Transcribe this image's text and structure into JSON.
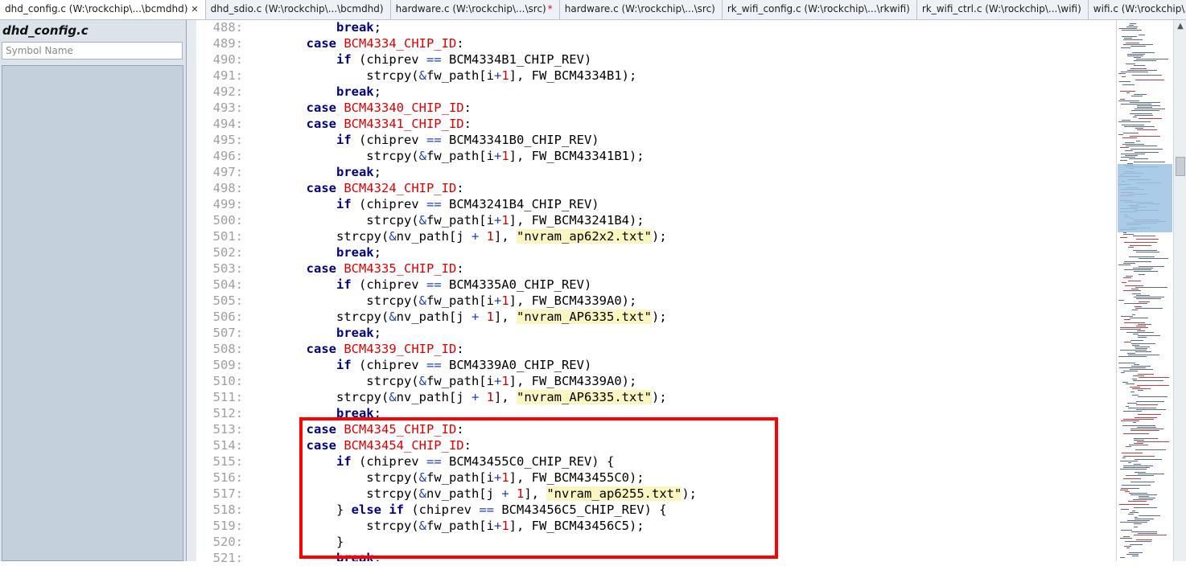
{
  "tabs": [
    {
      "label": "dhd_config.c (W:\\rockchip\\...\\bcmdhd)",
      "active": true,
      "close": "✕",
      "modified": ""
    },
    {
      "label": "dhd_sdio.c (W:\\rockchip\\...\\bcmdhd)",
      "active": false,
      "close": "",
      "modified": ""
    },
    {
      "label": "hardware.c (W:\\rockchip\\...\\src)",
      "active": false,
      "close": "",
      "modified": "*"
    },
    {
      "label": "hardware.c (W:\\rockchip\\...\\src)",
      "active": false,
      "close": "",
      "modified": ""
    },
    {
      "label": "rk_wifi_config.c (W:\\rockchip\\...\\rkwifi)",
      "active": false,
      "close": "",
      "modified": ""
    },
    {
      "label": "rk_wifi_ctrl.c (W:\\rockchip\\...\\wifi)",
      "active": false,
      "close": "",
      "modified": ""
    },
    {
      "label": "wifi.c (W:\\rockchip\\...\\wifi)",
      "active": false,
      "close": "",
      "modified": ""
    }
  ],
  "panel": {
    "title": "dhd_config.c",
    "search_placeholder": "Symbol Name"
  },
  "editor": {
    "line_numbers": [
      "488:",
      "489:",
      "490:",
      "491:",
      "492:",
      "493:",
      "494:",
      "495:",
      "496:",
      "497:",
      "498:",
      "499:",
      "500:",
      "501:",
      "502:",
      "503:",
      "504:",
      "505:",
      "506:",
      "507:",
      "508:",
      "509:",
      "510:",
      "511:",
      "512:",
      "513:",
      "514:",
      "515:",
      "516:",
      "517:",
      "518:",
      "519:",
      "520:",
      "521:"
    ],
    "lines": [
      [
        {
          "t": "            "
        },
        {
          "t": "break",
          "c": "kw"
        },
        {
          "t": ";"
        }
      ],
      [
        {
          "t": "        "
        },
        {
          "t": "case",
          "c": "kw"
        },
        {
          "t": " "
        },
        {
          "t": "BCM4334_CHIP_ID",
          "c": "mac"
        },
        {
          "t": ":"
        }
      ],
      [
        {
          "t": "            "
        },
        {
          "t": "if",
          "c": "kw"
        },
        {
          "t": " (chiprev "
        },
        {
          "t": "==",
          "c": "op"
        },
        {
          "t": " BCM4334B1_CHIP_REV)"
        }
      ],
      [
        {
          "t": "                strcpy("
        },
        {
          "t": "&",
          "c": "op"
        },
        {
          "t": "fw_path[i"
        },
        {
          "t": "+",
          "c": "op"
        },
        {
          "t": "1",
          "c": "num"
        },
        {
          "t": "], FW_BCM4334B1);"
        }
      ],
      [
        {
          "t": "            "
        },
        {
          "t": "break",
          "c": "kw"
        },
        {
          "t": ";"
        }
      ],
      [
        {
          "t": "        "
        },
        {
          "t": "case",
          "c": "kw"
        },
        {
          "t": " "
        },
        {
          "t": "BCM43340_CHIP_ID",
          "c": "mac"
        },
        {
          "t": ":"
        }
      ],
      [
        {
          "t": "        "
        },
        {
          "t": "case",
          "c": "kw"
        },
        {
          "t": " "
        },
        {
          "t": "BCM43341_CHIP_ID",
          "c": "mac"
        },
        {
          "t": ":"
        }
      ],
      [
        {
          "t": "            "
        },
        {
          "t": "if",
          "c": "kw"
        },
        {
          "t": " (chiprev "
        },
        {
          "t": "==",
          "c": "op"
        },
        {
          "t": " BCM43341B0_CHIP_REV)"
        }
      ],
      [
        {
          "t": "                strcpy("
        },
        {
          "t": "&",
          "c": "op"
        },
        {
          "t": "fw_path[i"
        },
        {
          "t": "+",
          "c": "op"
        },
        {
          "t": "1",
          "c": "num"
        },
        {
          "t": "], FW_BCM43341B1);"
        }
      ],
      [
        {
          "t": "            "
        },
        {
          "t": "break",
          "c": "kw"
        },
        {
          "t": ";"
        }
      ],
      [
        {
          "t": "        "
        },
        {
          "t": "case",
          "c": "kw"
        },
        {
          "t": " "
        },
        {
          "t": "BCM4324_CHIP_ID",
          "c": "mac"
        },
        {
          "t": ":"
        }
      ],
      [
        {
          "t": "            "
        },
        {
          "t": "if",
          "c": "kw"
        },
        {
          "t": " (chiprev "
        },
        {
          "t": "==",
          "c": "op"
        },
        {
          "t": " BCM43241B4_CHIP_REV)"
        }
      ],
      [
        {
          "t": "                strcpy("
        },
        {
          "t": "&",
          "c": "op"
        },
        {
          "t": "fw_path[i"
        },
        {
          "t": "+",
          "c": "op"
        },
        {
          "t": "1",
          "c": "num"
        },
        {
          "t": "], FW_BCM43241B4);"
        }
      ],
      [
        {
          "t": "            strcpy("
        },
        {
          "t": "&",
          "c": "op"
        },
        {
          "t": "nv_path[j "
        },
        {
          "t": "+",
          "c": "op"
        },
        {
          "t": " "
        },
        {
          "t": "1",
          "c": "num"
        },
        {
          "t": "], "
        },
        {
          "t": "\"nvram_ap62x2.txt\"",
          "c": "str"
        },
        {
          "t": ");"
        }
      ],
      [
        {
          "t": "            "
        },
        {
          "t": "break",
          "c": "kw"
        },
        {
          "t": ";"
        }
      ],
      [
        {
          "t": "        "
        },
        {
          "t": "case",
          "c": "kw"
        },
        {
          "t": " "
        },
        {
          "t": "BCM4335_CHIP_ID",
          "c": "mac"
        },
        {
          "t": ":"
        }
      ],
      [
        {
          "t": "            "
        },
        {
          "t": "if",
          "c": "kw"
        },
        {
          "t": " (chiprev "
        },
        {
          "t": "==",
          "c": "op"
        },
        {
          "t": " BCM4335A0_CHIP_REV)"
        }
      ],
      [
        {
          "t": "                strcpy("
        },
        {
          "t": "&",
          "c": "op"
        },
        {
          "t": "fw_path[i"
        },
        {
          "t": "+",
          "c": "op"
        },
        {
          "t": "1",
          "c": "num"
        },
        {
          "t": "], FW_BCM4339A0);"
        }
      ],
      [
        {
          "t": "            strcpy("
        },
        {
          "t": "&",
          "c": "op"
        },
        {
          "t": "nv_path[j "
        },
        {
          "t": "+",
          "c": "op"
        },
        {
          "t": " "
        },
        {
          "t": "1",
          "c": "num"
        },
        {
          "t": "], "
        },
        {
          "t": "\"nvram_AP6335.txt\"",
          "c": "str"
        },
        {
          "t": ");"
        }
      ],
      [
        {
          "t": "            "
        },
        {
          "t": "break",
          "c": "kw"
        },
        {
          "t": ";"
        }
      ],
      [
        {
          "t": "        "
        },
        {
          "t": "case",
          "c": "kw"
        },
        {
          "t": " "
        },
        {
          "t": "BCM4339_CHIP_ID",
          "c": "mac"
        },
        {
          "t": ":"
        }
      ],
      [
        {
          "t": "            "
        },
        {
          "t": "if",
          "c": "kw"
        },
        {
          "t": " (chiprev "
        },
        {
          "t": "==",
          "c": "op"
        },
        {
          "t": " BCM4339A0_CHIP_REV)"
        }
      ],
      [
        {
          "t": "                strcpy("
        },
        {
          "t": "&",
          "c": "op"
        },
        {
          "t": "fw_path[i"
        },
        {
          "t": "+",
          "c": "op"
        },
        {
          "t": "1",
          "c": "num"
        },
        {
          "t": "], FW_BCM4339A0);"
        }
      ],
      [
        {
          "t": "            strcpy("
        },
        {
          "t": "&",
          "c": "op"
        },
        {
          "t": "nv_path[j "
        },
        {
          "t": "+",
          "c": "op"
        },
        {
          "t": " "
        },
        {
          "t": "1",
          "c": "num"
        },
        {
          "t": "], "
        },
        {
          "t": "\"nvram_AP6335.txt\"",
          "c": "str"
        },
        {
          "t": ");"
        }
      ],
      [
        {
          "t": "            "
        },
        {
          "t": "break",
          "c": "kw"
        },
        {
          "t": ";"
        }
      ],
      [
        {
          "t": "        "
        },
        {
          "t": "case",
          "c": "kw"
        },
        {
          "t": " "
        },
        {
          "t": "BCM4345_CHIP_ID",
          "c": "mac"
        },
        {
          "t": ":"
        }
      ],
      [
        {
          "t": "        "
        },
        {
          "t": "case",
          "c": "kw"
        },
        {
          "t": " "
        },
        {
          "t": "BCM43454_CHIP_ID",
          "c": "mac"
        },
        {
          "t": ":"
        }
      ],
      [
        {
          "t": "            "
        },
        {
          "t": "if",
          "c": "kw"
        },
        {
          "t": " (chiprev "
        },
        {
          "t": "==",
          "c": "op"
        },
        {
          "t": " BCM43455C0_CHIP_REV) {"
        }
      ],
      [
        {
          "t": "                strcpy("
        },
        {
          "t": "&",
          "c": "op"
        },
        {
          "t": "fw_path[i"
        },
        {
          "t": "+",
          "c": "op"
        },
        {
          "t": "1",
          "c": "num"
        },
        {
          "t": "], FW_BCM43455C0);"
        }
      ],
      [
        {
          "t": "                strcpy("
        },
        {
          "t": "&",
          "c": "op"
        },
        {
          "t": "nv_path[j "
        },
        {
          "t": "+",
          "c": "op"
        },
        {
          "t": " "
        },
        {
          "t": "1",
          "c": "num"
        },
        {
          "t": "], "
        },
        {
          "t": "\"nvram_ap6255.txt\"",
          "c": "str"
        },
        {
          "t": ");"
        }
      ],
      [
        {
          "t": "            } "
        },
        {
          "t": "else",
          "c": "kw"
        },
        {
          "t": " "
        },
        {
          "t": "if",
          "c": "kw"
        },
        {
          "t": " (chiprev "
        },
        {
          "t": "==",
          "c": "op"
        },
        {
          "t": " BCM43456C5_CHIP_REV) {"
        }
      ],
      [
        {
          "t": "                strcpy("
        },
        {
          "t": "&",
          "c": "op"
        },
        {
          "t": "fw_path[i"
        },
        {
          "t": "+",
          "c": "op"
        },
        {
          "t": "1",
          "c": "num"
        },
        {
          "t": "], FW_BCM43456C5);"
        }
      ],
      [
        {
          "t": "            }"
        }
      ],
      [
        {
          "t": "            "
        },
        {
          "t": "break",
          "c": "kw"
        },
        {
          "t": ";"
        }
      ]
    ]
  },
  "colors": {
    "highlight": "#ff0000",
    "keyword": "#000080",
    "macro": "#e00000",
    "string_bg": "#fbf5c0",
    "line_number": "#a0a0a0"
  },
  "icons": {
    "scroll_up": "▲"
  }
}
